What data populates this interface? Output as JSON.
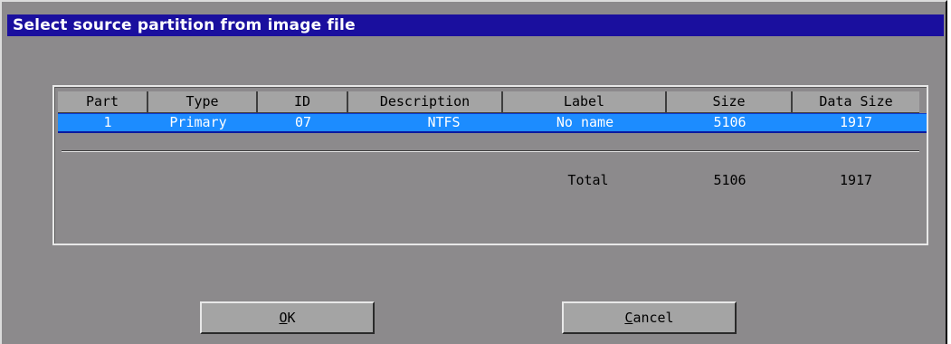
{
  "dialog": {
    "title": "Select source partition from image file"
  },
  "table": {
    "columns": [
      "Part",
      "Type",
      "ID",
      "Description",
      "Label",
      "Size",
      "Data Size"
    ],
    "rows": [
      {
        "part": "1",
        "type": "Primary",
        "id": "07",
        "description": "NTFS",
        "label": "No name",
        "size": "5106",
        "data_size": "1917",
        "selected": true
      }
    ],
    "total": {
      "label": "Total",
      "size": "5106",
      "data_size": "1917"
    }
  },
  "buttons": {
    "ok": {
      "mnemonic": "O",
      "rest": "K"
    },
    "cancel": {
      "mnemonic": "C",
      "rest": "ancel"
    }
  },
  "colors": {
    "title_bar": "#1a0f9e",
    "selected_row": "#1c8cff",
    "dialog_bg": "#8c8a8c"
  }
}
